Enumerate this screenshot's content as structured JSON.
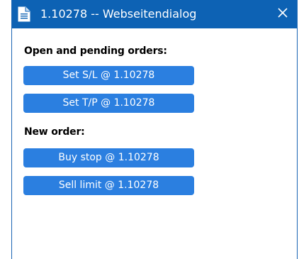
{
  "window": {
    "title": "1.10278 -- Webseitendialog"
  },
  "icons": {
    "document": "document-icon",
    "close": "close-icon"
  },
  "sections": {
    "open_orders": {
      "heading": "Open and pending orders:",
      "buttons": {
        "set_sl": "Set S/L @ 1.10278",
        "set_tp": "Set T/P @ 1.10278"
      }
    },
    "new_order": {
      "heading": "New order:",
      "buttons": {
        "buy_stop": "Buy stop @ 1.10278",
        "sell_limit": "Sell limit @ 1.10278"
      }
    }
  },
  "colors": {
    "titlebar": "#0d62b4",
    "button": "#2b7fe0",
    "border": "#1a65b3"
  }
}
